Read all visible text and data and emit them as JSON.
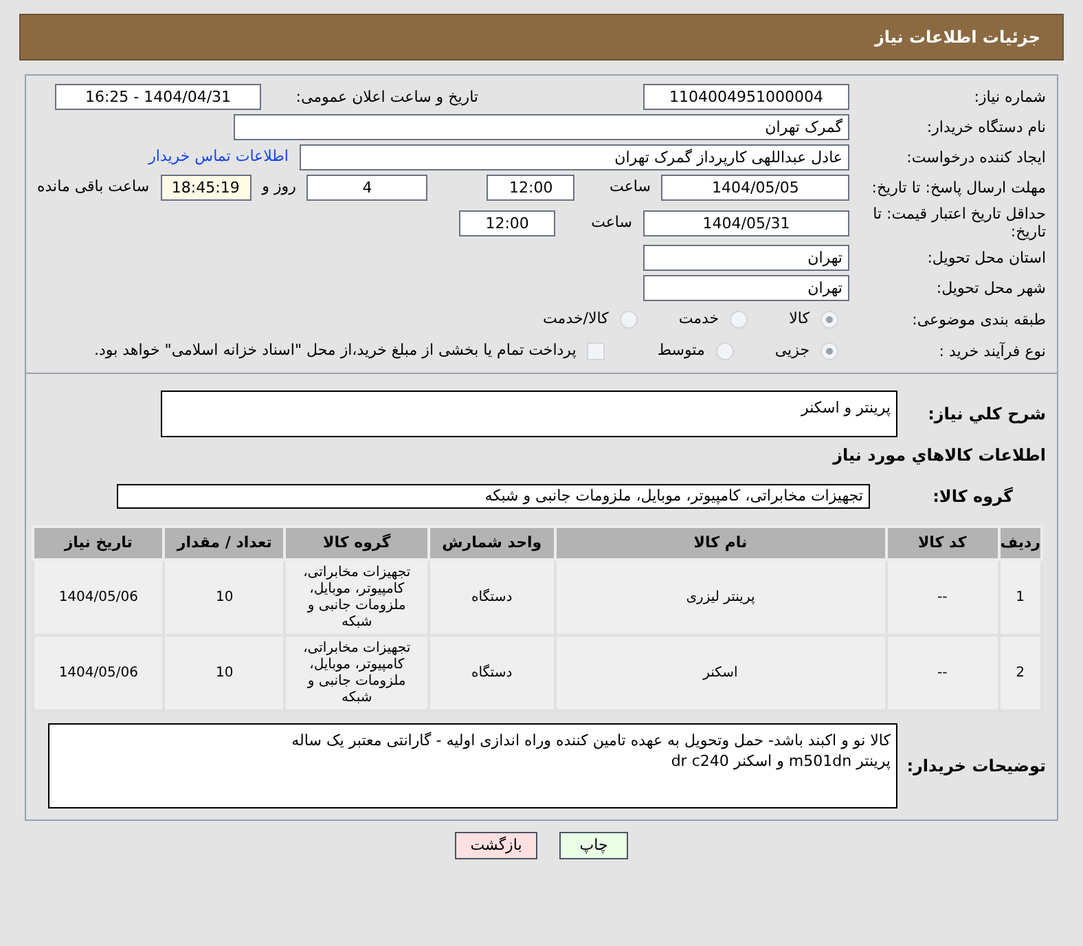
{
  "header": {
    "title": "جزئیات اطلاعات نیاز"
  },
  "need_number": {
    "label": "شماره نیاز:",
    "value": "1104004951000004"
  },
  "announce": {
    "label": "تاریخ و ساعت اعلان عمومی:",
    "value": "1404/04/31 - 16:25"
  },
  "buyer_org": {
    "label": "نام دستگاه خریدار:",
    "value": "گمرک تهران"
  },
  "requester": {
    "label": "ایجاد کننده درخواست:",
    "value": "عادل عبداللهی کارپرداز گمرک تهران",
    "link": "اطلاعات تماس خریدار"
  },
  "reply_deadline": {
    "label": "مهلت ارسال پاسخ: تا تاریخ:",
    "date": "1404/05/05",
    "time_label": "ساعت",
    "time": "12:00",
    "days": "4",
    "days_label": "روز و",
    "remaining": "18:45:19",
    "remaining_label": "ساعت باقی مانده"
  },
  "price_validity": {
    "label": "حداقل تاریخ اعتبار قیمت: تا تاریخ:",
    "date": "1404/05/31",
    "time_label": "ساعت",
    "time": "12:00"
  },
  "province": {
    "label": "استان محل تحویل:",
    "value": "تهران"
  },
  "city": {
    "label": "شهر محل تحویل:",
    "value": "تهران"
  },
  "category": {
    "label": "طبقه بندی موضوعی:",
    "options": [
      {
        "label": "کالا",
        "selected": true
      },
      {
        "label": "خدمت",
        "selected": false
      },
      {
        "label": "کالا/خدمت",
        "selected": false
      }
    ]
  },
  "process": {
    "label": "نوع فرآیند خرید :",
    "options": [
      {
        "label": "جزیی",
        "selected": true
      },
      {
        "label": "متوسط",
        "selected": false
      }
    ],
    "payment": {
      "label": "پرداخت تمام یا بخشی از مبلغ خرید،از محل \"اسناد خزانه اسلامی\" خواهد بود.",
      "checked": false
    }
  },
  "description": {
    "label": "شرح کلي نياز:",
    "value": "پرینتر و اسکنر"
  },
  "goods_title": "اطلاعات کالاهاي مورد نياز",
  "goods_group": {
    "label": "گروه کالا:",
    "value": "تجهیزات مخابراتی، کامپیوتر، موبایل، ملزومات جانبی و شبکه"
  },
  "table": {
    "columns": [
      "ردیف",
      "کد کالا",
      "نام کالا",
      "واحد شمارش",
      "گروه کالا",
      "تعداد / مقدار",
      "تاریخ نیاز"
    ],
    "rows": [
      [
        "1",
        "--",
        "پرینتر لیزری",
        "دستگاه",
        "تجهیزات مخابراتی، کامپیوتر، موبایل، ملزومات جانبی و شبکه",
        "10",
        "1404/05/06"
      ],
      [
        "2",
        "--",
        "اسکنر",
        "دستگاه",
        "تجهیزات مخابراتی، کامپیوتر، موبایل، ملزومات جانبی و شبکه",
        "10",
        "1404/05/06"
      ]
    ]
  },
  "buyer_notes": {
    "label": "توضیحات خریدار:",
    "lines": [
      "کالا نو و اکبند باشد- حمل وتحویل به عهده تامین کننده وراه اندازی اولیه - گارانتی معتبر یک ساله",
      "پرینتر m501dn و اسکنر dr c240"
    ]
  },
  "buttons": [
    {
      "label": "چاپ",
      "kind": "print"
    },
    {
      "label": "بازگشت",
      "kind": "back"
    }
  ]
}
